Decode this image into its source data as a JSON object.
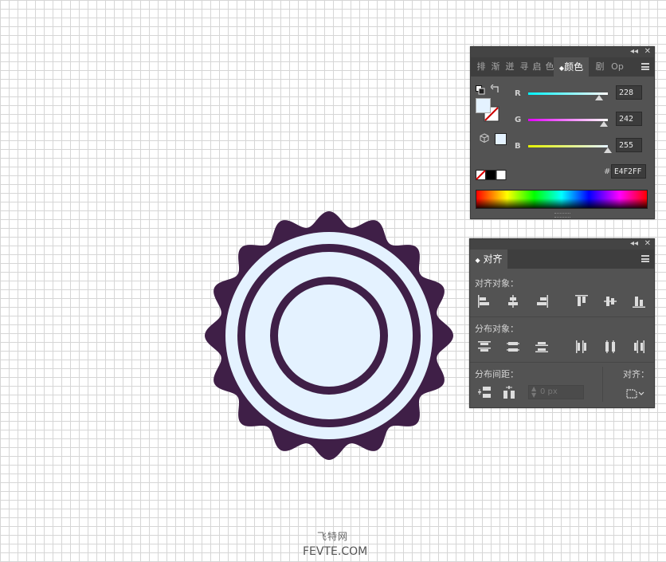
{
  "colors": {
    "badge_outer": "#3f1f47",
    "badge_fill": "#e4f2ff",
    "panel_bg": "#535353"
  },
  "color_panel": {
    "tabs": [
      "排",
      "渐",
      "迸",
      "寻",
      "启",
      "色"
    ],
    "active_tab": "颜色",
    "trailing_tabs": [
      "剧",
      "Op"
    ],
    "channels": [
      {
        "label": "R",
        "value": "228",
        "fraction": 0.894
      },
      {
        "label": "G",
        "value": "242",
        "fraction": 0.949
      },
      {
        "label": "B",
        "value": "255",
        "fraction": 1.0
      }
    ],
    "hex_symbol": "#",
    "hex_value": "E4F2FF"
  },
  "align_panel": {
    "title": "对齐",
    "align_objects_label": "对齐对象：",
    "distribute_objects_label": "分布对象：",
    "distribute_spacing_label": "分布间距：",
    "align_to_label": "对齐：",
    "spacing_value": "0 px"
  },
  "watermark": {
    "line1": "飞特网",
    "line2": "FEVTE.COM"
  }
}
